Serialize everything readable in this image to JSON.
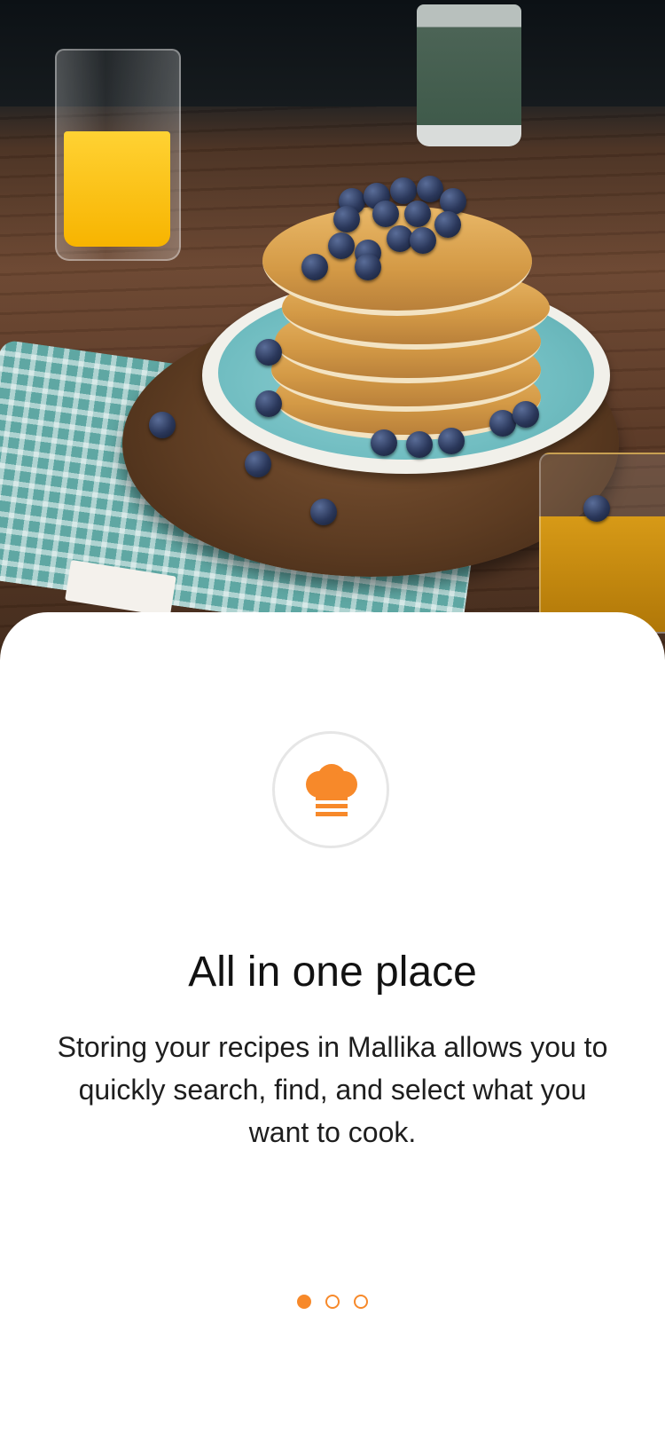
{
  "accent_color": "#f7892a",
  "hero": {
    "image_description_icon": "pancakes-photo"
  },
  "onboarding": {
    "icon": "chef-hat-icon",
    "title": "All in one place",
    "description": "Storing your recipes in Mallika allows you to quickly search, find, and select what you want to cook.",
    "pager": {
      "total_pages": 3,
      "current_page": 1
    }
  }
}
